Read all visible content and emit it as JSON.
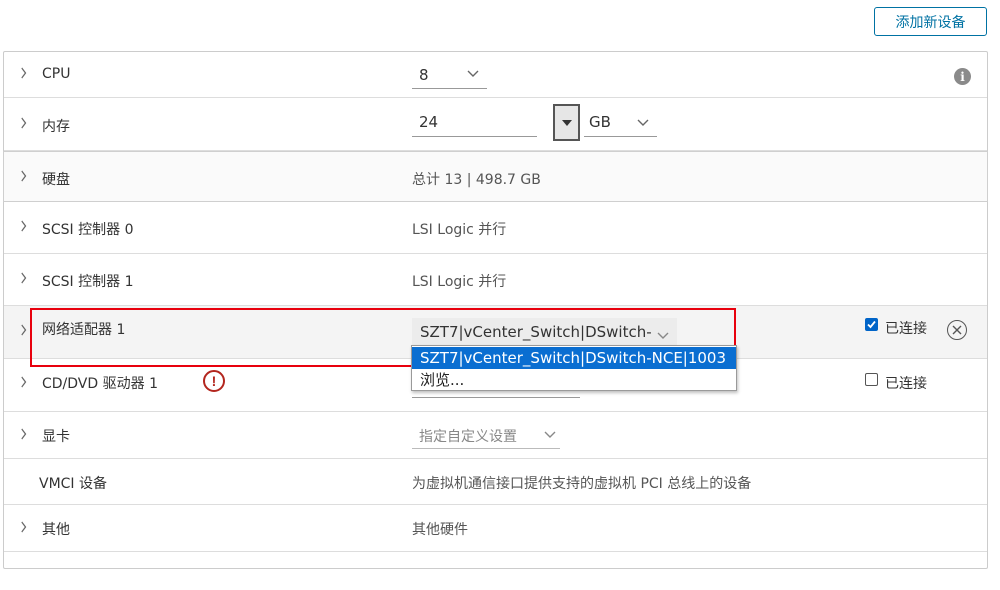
{
  "toolbar": {
    "add_device_label": "添加新设备"
  },
  "rows": {
    "cpu": {
      "label": "CPU",
      "value": "8"
    },
    "memory": {
      "label": "内存",
      "value": "24",
      "unit": "GB"
    },
    "disk": {
      "label": "硬盘",
      "value": "总计 13 | 498.7 GB"
    },
    "scsi0": {
      "label": "SCSI 控制器 0",
      "value": "LSI Logic 并行"
    },
    "scsi1": {
      "label": "SCSI 控制器 1",
      "value": "LSI Logic 并行"
    },
    "network": {
      "label": "网络适配器 1",
      "value": "SZT7|vCenter_Switch|DSwitch-NCE|1003",
      "connected_label": "已连接",
      "connected": true
    },
    "cdrom": {
      "label": "CD/DVD 驱动器 1",
      "connected_label": "已连接",
      "connected": false
    },
    "video": {
      "label": "显卡",
      "value": "指定自定义设置"
    },
    "vmci": {
      "label": "VMCI 设备",
      "value": "为虚拟机通信接口提供支持的虚拟机 PCI 总线上的设备"
    },
    "other": {
      "label": "其他",
      "value": "其他硬件"
    }
  },
  "network_dropdown": {
    "options": [
      "SZT7|vCenter_Switch|DSwitch-NCE|1003",
      "浏览..."
    ],
    "selected_index": 0
  },
  "icons": {
    "expand": "chevron-right-icon",
    "select": "chevron-down-icon",
    "info": "info-icon",
    "remove": "close-circle-icon",
    "warning": "warning-icon"
  },
  "colors": {
    "accent": "#0072a3",
    "selection": "#0a6ed1",
    "highlight_box": "#e8000d",
    "warning": "#b3261e",
    "checkbox": "#0064c8"
  }
}
